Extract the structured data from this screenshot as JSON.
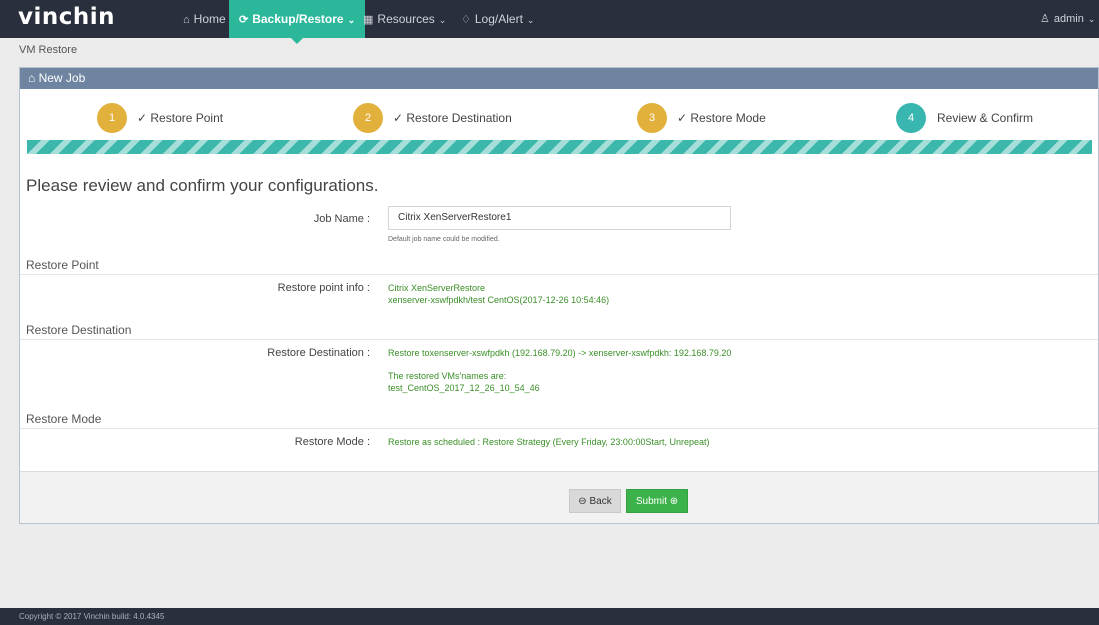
{
  "header": {
    "logo": "vinchin",
    "nav": [
      {
        "label": "Home",
        "icon": "home-icon"
      },
      {
        "label": "Backup/Restore",
        "icon": "refresh-icon"
      },
      {
        "label": "Resources",
        "icon": "grid-icon"
      },
      {
        "label": "Log/Alert",
        "icon": "bell-icon"
      }
    ],
    "user": "admin"
  },
  "breadcrumb": "VM Restore",
  "panel": {
    "title": "New Job",
    "steps": [
      {
        "num": "1",
        "label": "Restore Point",
        "state": "done"
      },
      {
        "num": "2",
        "label": "Restore Destination",
        "state": "done"
      },
      {
        "num": "3",
        "label": "Restore Mode",
        "state": "done"
      },
      {
        "num": "4",
        "label": "Review & Confirm",
        "state": "active"
      }
    ],
    "heading": "Please review and confirm your configurations.",
    "job_name": {
      "label": "Job Name :",
      "value": "Citrix XenServerRestore1",
      "hint": "Default job name could be modified."
    },
    "restore_point": {
      "section": "Restore Point",
      "label": "Restore point info :",
      "line1": "Citrix XenServerRestore",
      "line2": "xenserver-xswfpdkh/test CentOS(2017-12-26 10:54:46)"
    },
    "restore_destination": {
      "section": "Restore Destination",
      "label": "Restore Destination :",
      "line1": "Restore toxenserver-xswfpdkh (192.168.79.20) -> xenserver-xswfpdkh: 192.168.79.20",
      "line2": "The restored VMs'names are:",
      "line3": "test_CentOS_2017_12_26_10_54_46"
    },
    "restore_mode": {
      "section": "Restore Mode",
      "label": "Restore Mode :",
      "value": "Restore as scheduled : Restore Strategy (Every Friday, 23:00:00Start, Unrepeat)"
    },
    "buttons": {
      "back": "Back",
      "submit": "Submit"
    }
  },
  "footer": "Copyright © 2017 Vinchin build: 4.0.4345",
  "colors": {
    "nav_bg": "#2a2f3d",
    "accent": "#2bb89a",
    "step_done": "#e1b13b",
    "step_active": "#3ab6b0",
    "value_green": "#3a8f27",
    "submit": "#3cb24a"
  }
}
